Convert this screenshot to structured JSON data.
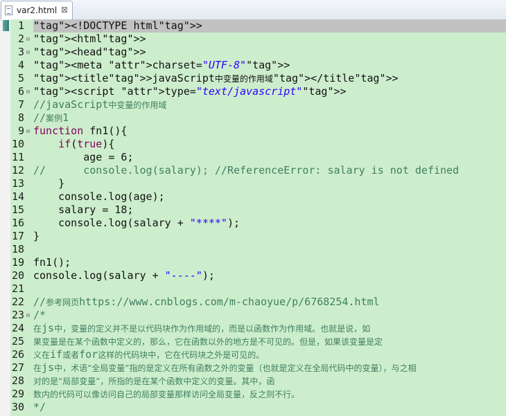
{
  "tab": {
    "title": "var2.html",
    "close_glyph": "⊠",
    "icon": "html-file-icon"
  },
  "lines": [
    {
      "n": "1",
      "fold": "",
      "text": "<!DOCTYPE html>"
    },
    {
      "n": "2",
      "fold": "⊖",
      "text": "<html>"
    },
    {
      "n": "3",
      "fold": "⊖",
      "text": "<head>"
    },
    {
      "n": "4",
      "fold": "",
      "text": "<meta charset=\"UTF-8\">"
    },
    {
      "n": "5",
      "fold": "",
      "text": "<title>javaScript中变量的作用域</title>"
    },
    {
      "n": "6",
      "fold": "⊖",
      "text": "<script type=\"text/javascript\">"
    },
    {
      "n": "7",
      "fold": "",
      "text": "//javaScript中变量的作用域"
    },
    {
      "n": "8",
      "fold": "",
      "text": "//案例1"
    },
    {
      "n": "9",
      "fold": "⊖",
      "text": "function fn1(){"
    },
    {
      "n": "10",
      "fold": "",
      "text": "    if(true){"
    },
    {
      "n": "11",
      "fold": "",
      "text": "        age = 6;"
    },
    {
      "n": "12",
      "fold": "",
      "text": "//      console.log(salary); //ReferenceError: salary is not defined"
    },
    {
      "n": "13",
      "fold": "",
      "text": "    }"
    },
    {
      "n": "14",
      "fold": "",
      "text": "    console.log(age);"
    },
    {
      "n": "15",
      "fold": "",
      "text": "    salary = 18;"
    },
    {
      "n": "16",
      "fold": "",
      "text": "    console.log(salary + \"****\");"
    },
    {
      "n": "17",
      "fold": "",
      "text": "}"
    },
    {
      "n": "18",
      "fold": "",
      "text": ""
    },
    {
      "n": "19",
      "fold": "",
      "text": "fn1();"
    },
    {
      "n": "20",
      "fold": "",
      "text": "console.log(salary + \"----\");"
    },
    {
      "n": "21",
      "fold": "",
      "text": ""
    },
    {
      "n": "22",
      "fold": "",
      "text": "//参考网页https://www.cnblogs.com/m-chaoyue/p/6768254.html"
    },
    {
      "n": "23",
      "fold": "⊖",
      "text": "/*"
    },
    {
      "n": "24",
      "fold": "",
      "text": "在js中，变量的定义并不是以代码块作为作用域的，而是以函数作为作用域。也就是说，如"
    },
    {
      "n": "25",
      "fold": "",
      "text": "果变量是在某个函数中定义的，那么，它在函数以外的地方是不可见的。但是，如果该变量是定"
    },
    {
      "n": "26",
      "fold": "",
      "text": "义在if或者for这样的代码块中，它在代码块之外是可见的。"
    },
    {
      "n": "27",
      "fold": "",
      "text": "在js中，术语“全局变量”指的是定义在所有函数之外的变量（也就是定义在全局代码中的变量），与之相"
    },
    {
      "n": "28",
      "fold": "",
      "text": "对的是“局部变量”，所指的是在某个函数中定义的变量。其中，函"
    },
    {
      "n": "29",
      "fold": "",
      "text": "数内的代码可以像访问自己的局部变量那样访问全局变量，反之则不行。"
    },
    {
      "n": "30",
      "fold": "",
      "text": "*/"
    }
  ],
  "colors": {
    "editor_background": "#cdeecd",
    "current_line": "#c2c2c2",
    "tag": "#2c8ea1",
    "keyword": "#7f0055",
    "string": "#2a00ff",
    "comment": "#3f7f5f"
  }
}
